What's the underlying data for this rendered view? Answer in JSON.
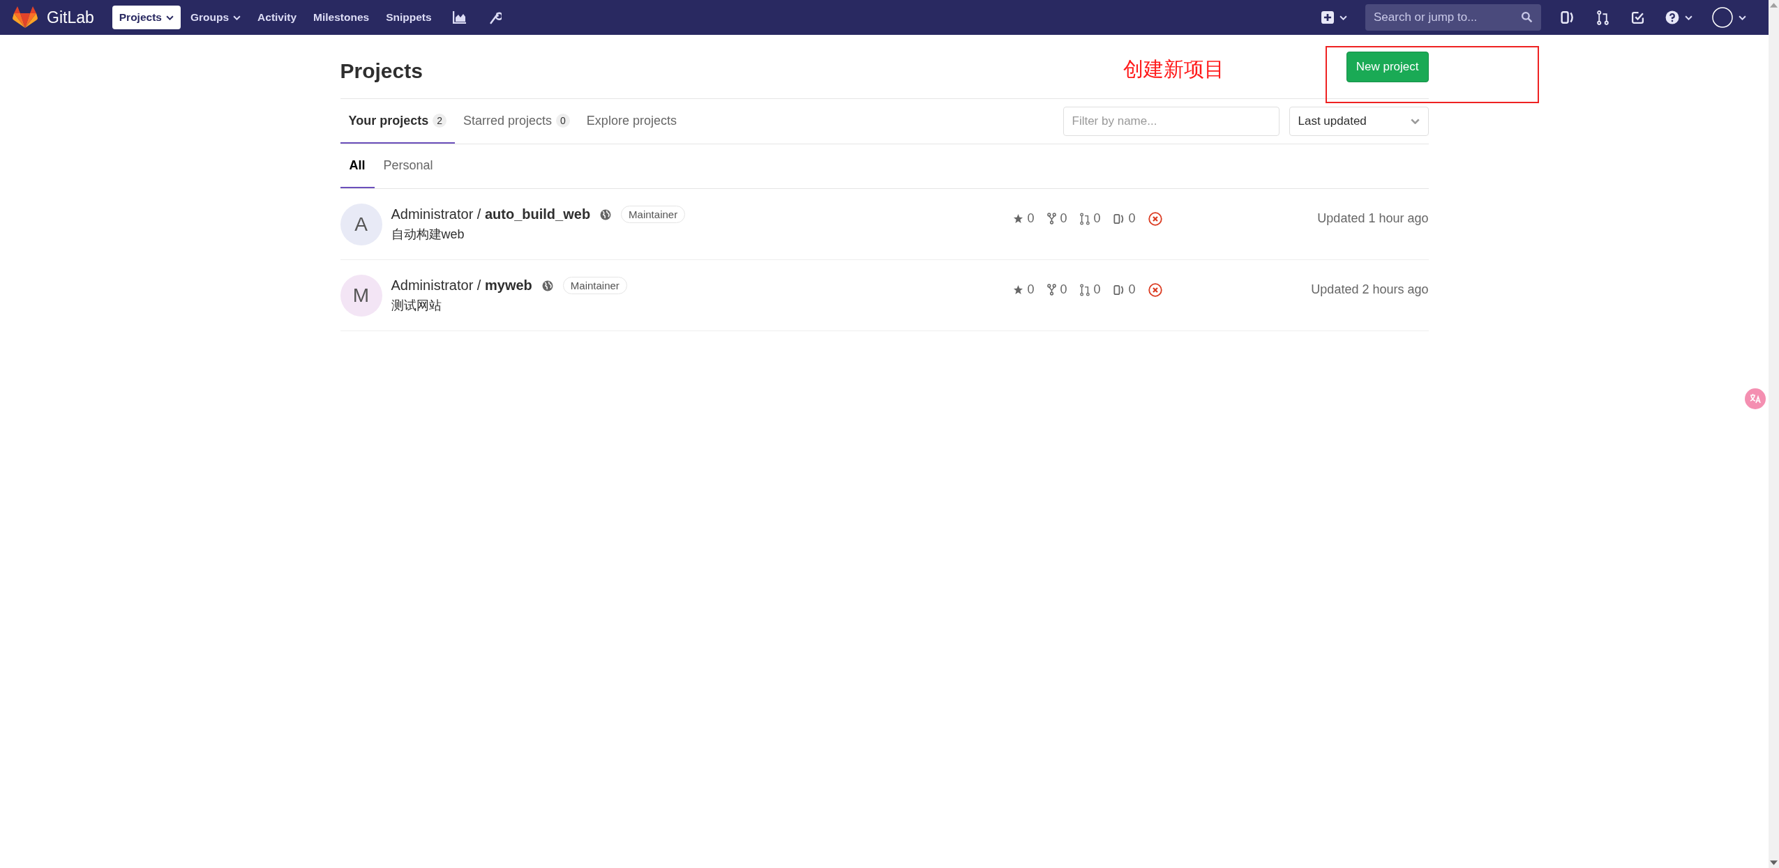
{
  "navbar": {
    "brand": "GitLab",
    "links": [
      {
        "label": "Projects",
        "selected": true,
        "dropdown": true
      },
      {
        "label": "Groups",
        "selected": false,
        "dropdown": true
      },
      {
        "label": "Activity",
        "selected": false,
        "dropdown": false
      },
      {
        "label": "Milestones",
        "selected": false,
        "dropdown": false
      },
      {
        "label": "Snippets",
        "selected": false,
        "dropdown": false
      }
    ],
    "search": {
      "placeholder": "Search or jump to..."
    }
  },
  "page": {
    "title": "Projects",
    "new_button": "New project",
    "annotation": "创建新项目"
  },
  "tabs": [
    {
      "label": "Your projects",
      "count": "2",
      "selected": true
    },
    {
      "label": "Starred projects",
      "count": "0",
      "selected": false
    },
    {
      "label": "Explore projects",
      "selected": false
    }
  ],
  "filter": {
    "placeholder": "Filter by name..."
  },
  "sort": {
    "value": "Last updated"
  },
  "subtabs": [
    {
      "label": "All",
      "selected": true
    },
    {
      "label": "Personal",
      "selected": false
    }
  ],
  "projects": [
    {
      "avatar": "A",
      "color": "#e8eaf6",
      "title": "Administrator / **auto_build_web**",
      "role": "Maintainer",
      "description": "自动构建web",
      "star_count": "0",
      "fork_count": "0",
      "mr_count": "0",
      "issue_count": "0",
      "pipeline_failed": true,
      "updated": "Updated 1 hour ago"
    },
    {
      "avatar": "M",
      "color": "#f3e5f5",
      "title": "Administrator / **myweb**",
      "role": "Maintainer",
      "description": "测试网站",
      "star_count": "0",
      "fork_count": "0",
      "mr_count": "0",
      "issue_count": "0",
      "pipeline_failed": true,
      "updated": "Updated 2 hours ago"
    }
  ]
}
